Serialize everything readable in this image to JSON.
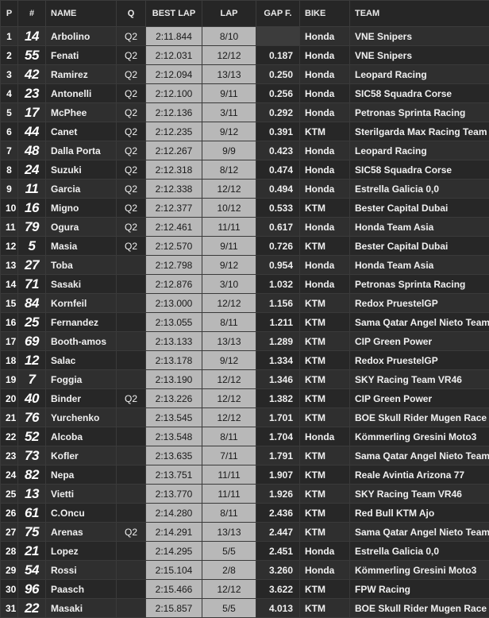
{
  "headers": {
    "pos": "P",
    "num": "#",
    "name": "NAME",
    "q": "Q",
    "best": "BEST LAP",
    "lap": "LAP",
    "gap": "GAP F.",
    "bike": "BIKE",
    "team": "TEAM"
  },
  "rows": [
    {
      "pos": "1",
      "num": "14",
      "name": "Arbolino",
      "q": "Q2",
      "best": "2:11.844",
      "lap": "8/10",
      "gap": "",
      "bike": "Honda",
      "team": "VNE Snipers"
    },
    {
      "pos": "2",
      "num": "55",
      "name": "Fenati",
      "q": "Q2",
      "best": "2:12.031",
      "lap": "12/12",
      "gap": "0.187",
      "bike": "Honda",
      "team": "VNE Snipers"
    },
    {
      "pos": "3",
      "num": "42",
      "name": "Ramirez",
      "q": "Q2",
      "best": "2:12.094",
      "lap": "13/13",
      "gap": "0.250",
      "bike": "Honda",
      "team": "Leopard Racing"
    },
    {
      "pos": "4",
      "num": "23",
      "name": "Antonelli",
      "q": "Q2",
      "best": "2:12.100",
      "lap": "9/11",
      "gap": "0.256",
      "bike": "Honda",
      "team": "SIC58 Squadra Corse"
    },
    {
      "pos": "5",
      "num": "17",
      "name": "McPhee",
      "q": "Q2",
      "best": "2:12.136",
      "lap": "3/11",
      "gap": "0.292",
      "bike": "Honda",
      "team": "Petronas Sprinta Racing"
    },
    {
      "pos": "6",
      "num": "44",
      "name": "Canet",
      "q": "Q2",
      "best": "2:12.235",
      "lap": "9/12",
      "gap": "0.391",
      "bike": "KTM",
      "team": "Sterilgarda Max Racing Team"
    },
    {
      "pos": "7",
      "num": "48",
      "name": "Dalla Porta",
      "q": "Q2",
      "best": "2:12.267",
      "lap": "9/9",
      "gap": "0.423",
      "bike": "Honda",
      "team": "Leopard Racing"
    },
    {
      "pos": "8",
      "num": "24",
      "name": "Suzuki",
      "q": "Q2",
      "best": "2:12.318",
      "lap": "8/12",
      "gap": "0.474",
      "bike": "Honda",
      "team": "SIC58 Squadra Corse"
    },
    {
      "pos": "9",
      "num": "11",
      "name": "Garcia",
      "q": "Q2",
      "best": "2:12.338",
      "lap": "12/12",
      "gap": "0.494",
      "bike": "Honda",
      "team": "Estrella Galicia 0,0"
    },
    {
      "pos": "10",
      "num": "16",
      "name": "Migno",
      "q": "Q2",
      "best": "2:12.377",
      "lap": "10/12",
      "gap": "0.533",
      "bike": "KTM",
      "team": "Bester Capital Dubai"
    },
    {
      "pos": "11",
      "num": "79",
      "name": "Ogura",
      "q": "Q2",
      "best": "2:12.461",
      "lap": "11/11",
      "gap": "0.617",
      "bike": "Honda",
      "team": "Honda Team Asia"
    },
    {
      "pos": "12",
      "num": "5",
      "name": "Masia",
      "q": "Q2",
      "best": "2:12.570",
      "lap": "9/11",
      "gap": "0.726",
      "bike": "KTM",
      "team": "Bester Capital Dubai"
    },
    {
      "pos": "13",
      "num": "27",
      "name": "Toba",
      "q": "",
      "best": "2:12.798",
      "lap": "9/12",
      "gap": "0.954",
      "bike": "Honda",
      "team": "Honda Team Asia"
    },
    {
      "pos": "14",
      "num": "71",
      "name": "Sasaki",
      "q": "",
      "best": "2:12.876",
      "lap": "3/10",
      "gap": "1.032",
      "bike": "Honda",
      "team": "Petronas Sprinta Racing"
    },
    {
      "pos": "15",
      "num": "84",
      "name": "Kornfeil",
      "q": "",
      "best": "2:13.000",
      "lap": "12/12",
      "gap": "1.156",
      "bike": "KTM",
      "team": "Redox PruestelGP"
    },
    {
      "pos": "16",
      "num": "25",
      "name": "Fernandez",
      "q": "",
      "best": "2:13.055",
      "lap": "8/11",
      "gap": "1.211",
      "bike": "KTM",
      "team": "Sama Qatar Angel Nieto Team"
    },
    {
      "pos": "17",
      "num": "69",
      "name": "Booth-amos",
      "q": "",
      "best": "2:13.133",
      "lap": "13/13",
      "gap": "1.289",
      "bike": "KTM",
      "team": "CIP Green Power"
    },
    {
      "pos": "18",
      "num": "12",
      "name": "Salac",
      "q": "",
      "best": "2:13.178",
      "lap": "9/12",
      "gap": "1.334",
      "bike": "KTM",
      "team": "Redox PruestelGP"
    },
    {
      "pos": "19",
      "num": "7",
      "name": "Foggia",
      "q": "",
      "best": "2:13.190",
      "lap": "12/12",
      "gap": "1.346",
      "bike": "KTM",
      "team": "SKY Racing Team VR46"
    },
    {
      "pos": "20",
      "num": "40",
      "name": "Binder",
      "q": "Q2",
      "best": "2:13.226",
      "lap": "12/12",
      "gap": "1.382",
      "bike": "KTM",
      "team": "CIP Green Power"
    },
    {
      "pos": "21",
      "num": "76",
      "name": "Yurchenko",
      "q": "",
      "best": "2:13.545",
      "lap": "12/12",
      "gap": "1.701",
      "bike": "KTM",
      "team": "BOE Skull Rider Mugen Race"
    },
    {
      "pos": "22",
      "num": "52",
      "name": "Alcoba",
      "q": "",
      "best": "2:13.548",
      "lap": "8/11",
      "gap": "1.704",
      "bike": "Honda",
      "team": "Kömmerling Gresini Moto3"
    },
    {
      "pos": "23",
      "num": "73",
      "name": "Kofler",
      "q": "",
      "best": "2:13.635",
      "lap": "7/11",
      "gap": "1.791",
      "bike": "KTM",
      "team": "Sama Qatar Angel Nieto Team"
    },
    {
      "pos": "24",
      "num": "82",
      "name": "Nepa",
      "q": "",
      "best": "2:13.751",
      "lap": "11/11",
      "gap": "1.907",
      "bike": "KTM",
      "team": "Reale Avintia Arizona 77"
    },
    {
      "pos": "25",
      "num": "13",
      "name": "Vietti",
      "q": "",
      "best": "2:13.770",
      "lap": "11/11",
      "gap": "1.926",
      "bike": "KTM",
      "team": "SKY Racing Team VR46"
    },
    {
      "pos": "26",
      "num": "61",
      "name": "C.Oncu",
      "q": "",
      "best": "2:14.280",
      "lap": "8/11",
      "gap": "2.436",
      "bike": "KTM",
      "team": "Red Bull KTM Ajo"
    },
    {
      "pos": "27",
      "num": "75",
      "name": "Arenas",
      "q": "Q2",
      "best": "2:14.291",
      "lap": "13/13",
      "gap": "2.447",
      "bike": "KTM",
      "team": "Sama Qatar Angel Nieto Team"
    },
    {
      "pos": "28",
      "num": "21",
      "name": "Lopez",
      "q": "",
      "best": "2:14.295",
      "lap": "5/5",
      "gap": "2.451",
      "bike": "Honda",
      "team": "Estrella Galicia 0,0"
    },
    {
      "pos": "29",
      "num": "54",
      "name": "Rossi",
      "q": "",
      "best": "2:15.104",
      "lap": "2/8",
      "gap": "3.260",
      "bike": "Honda",
      "team": "Kömmerling Gresini Moto3"
    },
    {
      "pos": "30",
      "num": "96",
      "name": "Paasch",
      "q": "",
      "best": "2:15.466",
      "lap": "12/12",
      "gap": "3.622",
      "bike": "KTM",
      "team": "FPW Racing"
    },
    {
      "pos": "31",
      "num": "22",
      "name": "Masaki",
      "q": "",
      "best": "2:15.857",
      "lap": "5/5",
      "gap": "4.013",
      "bike": "KTM",
      "team": "BOE Skull Rider Mugen Race"
    }
  ]
}
